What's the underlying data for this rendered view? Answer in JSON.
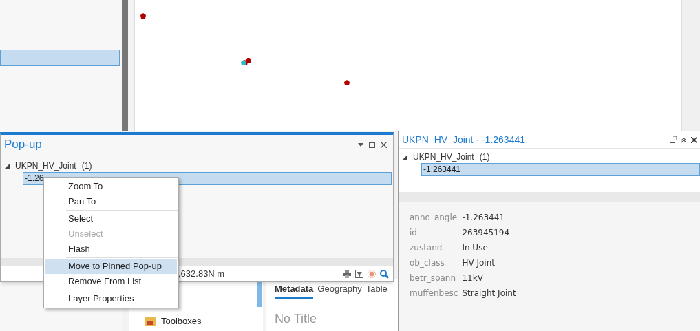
{
  "popup": {
    "title": "Pop-up",
    "layer": "UKPN_HV_Joint",
    "count": "(1)",
    "features": [
      {
        "label": "-1.26",
        "selected": true
      }
    ],
    "status": ",632.83N m"
  },
  "context_menu": [
    {
      "kind": "item",
      "label": "Zoom To",
      "disabled": false,
      "selected": false
    },
    {
      "kind": "item",
      "label": "Pan To",
      "disabled": false,
      "selected": false
    },
    {
      "kind": "separator"
    },
    {
      "kind": "item",
      "label": "Select",
      "disabled": false,
      "selected": false
    },
    {
      "kind": "item",
      "label": "Unselect",
      "disabled": true,
      "selected": false
    },
    {
      "kind": "item",
      "label": "Flash",
      "disabled": false,
      "selected": false
    },
    {
      "kind": "separator"
    },
    {
      "kind": "item",
      "label": "Move to Pinned Pop-up",
      "disabled": false,
      "selected": true
    },
    {
      "kind": "item",
      "label": "Remove From List",
      "disabled": false,
      "selected": false
    },
    {
      "kind": "separator"
    },
    {
      "kind": "item",
      "label": "Layer Properties",
      "disabled": false,
      "selected": false
    }
  ],
  "pinned_popup": {
    "title": "UKPN_HV_Joint - -1.263441",
    "layer": "UKPN_HV_Joint",
    "count": "(1)",
    "features": [
      {
        "label": "-1.263441",
        "selected": true
      }
    ],
    "attributes": [
      {
        "name": "anno_angle",
        "value": "-1.263441"
      },
      {
        "name": "id",
        "value": "263945194"
      },
      {
        "name": "zustand",
        "value": "In Use"
      },
      {
        "name": "ob_class",
        "value": "HV Joint"
      },
      {
        "name": "betr_spann",
        "value": "11kV"
      },
      {
        "name": "muffenbesc",
        "value": "Straight Joint"
      }
    ]
  },
  "catalog": {
    "items": [
      {
        "label": "Toolboxes"
      }
    ]
  },
  "metadata": {
    "tabs": [
      {
        "label": "Metadata",
        "selected": true
      },
      {
        "label": "Geography",
        "selected": false
      },
      {
        "label": "Table",
        "selected": false
      }
    ],
    "title": "No Title"
  }
}
